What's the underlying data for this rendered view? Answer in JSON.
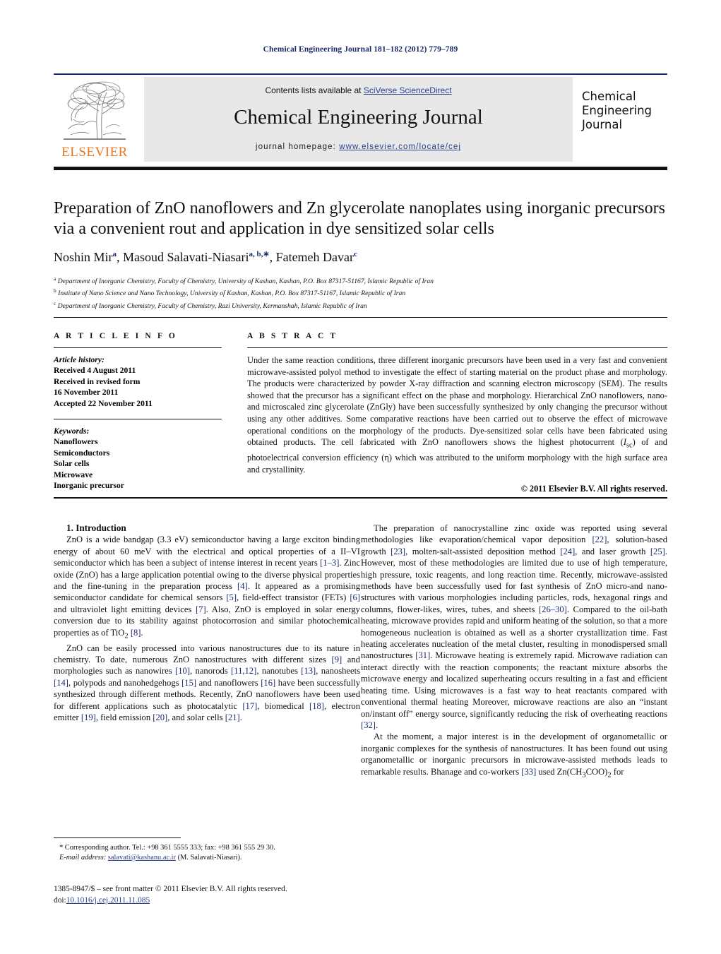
{
  "running_head": "Chemical Engineering Journal 181–182 (2012) 779–789",
  "masthead": {
    "publisher_name": "ELSEVIER",
    "contents_prefix": "Contents lists available at ",
    "contents_link": "SciVerse ScienceDirect",
    "journal_title": "Chemical Engineering Journal",
    "homepage_prefix": "journal homepage: ",
    "homepage_url": "www.elsevier.com/locate/cej",
    "cover_line1": "Chemical",
    "cover_line2": "Engineering",
    "cover_line3": "Journal",
    "accent_orange": "#E87722",
    "accent_blue": "#2b3f8c",
    "band_gray": "#e8e8e8"
  },
  "article": {
    "title": "Preparation of ZnO nanoflowers and Zn glycerolate nanoplates using inorganic precursors via a convenient rout and application in dye sensitized solar cells",
    "authors": [
      {
        "name": "Noshin Mir",
        "marks": "a"
      },
      {
        "name": "Masoud Salavati-Niasari",
        "marks": "a, b,∗"
      },
      {
        "name": "Fatemeh Davar",
        "marks": "c"
      }
    ],
    "affiliations": [
      {
        "mark": "a",
        "text": "Department of Inorganic Chemistry, Faculty of Chemistry, University of Kashan, Kashan, P.O. Box 87317-51167, Islamic Republic of Iran"
      },
      {
        "mark": "b",
        "text": "Institute of Nano Science and Nano Technology, University of Kashan, Kashan, P.O. Box 87317-51167, Islamic Republic of Iran"
      },
      {
        "mark": "c",
        "text": "Department of Inorganic Chemistry, Faculty of Chemistry, Razi University, Kermanshah, Islamic Republic of Iran"
      }
    ]
  },
  "article_info": {
    "heading": "A R T I C L E   I N F O",
    "history_label": "Article history:",
    "history": [
      "Received 4 August 2011",
      "Received in revised form",
      "16 November 2011",
      "Accepted 22 November 2011"
    ],
    "keywords_label": "Keywords:",
    "keywords": [
      "Nanoflowers",
      "Semiconductors",
      "Solar cells",
      "Microwave",
      "Inorganic precursor"
    ]
  },
  "abstract": {
    "heading": "A B S T R A C T",
    "text": "Under the same reaction conditions, three different inorganic precursors have been used in a very fast and convenient microwave-assisted polyol method to investigate the effect of starting material on the product phase and morphology. The products were characterized by powder X-ray diffraction and scanning electron microscopy (SEM). The results showed that the precursor has a significant effect on the phase and morphology. Hierarchical ZnO nanoflowers, nano- and microscaled zinc glycerolate (ZnGly) have been successfully synthesized by only changing the precursor without using any other additives. Some comparative reactions have been carried out to observe the effect of microwave operational conditions on the morphology of the products. Dye-sensitized solar cells have been fabricated using obtained products. The cell fabricated with ZnO nanoflowers shows the highest photocurrent (Isc) of and photoelectrical conversion efficiency (η) which was attributed to the uniform morphology with the high surface area and crystallinity.",
    "copyright": "© 2011 Elsevier B.V. All rights reserved."
  },
  "body": {
    "section_number": "1.",
    "section_title": "Introduction",
    "left_paragraphs": [
      "ZnO is a wide bandgap (3.3 eV) semiconductor having a large exciton binding energy of about 60 meV with the electrical and optical properties of a II–VI semiconductor which has been a subject of intense interest in recent years [1–3]. Zinc oxide (ZnO) has a large application potential owing to the diverse physical properties and the fine-tuning in the preparation process [4]. It appeared as a promising semiconductor candidate for chemical sensors [5], field-effect transistor (FETs) [6] and ultraviolet light emitting devices [7]. Also, ZnO is employed in solar energy conversion due to its stability against photocorrosion and similar photochemical properties as of TiO2 [8].",
      "ZnO can be easily processed into various nanostructures due to its nature in chemistry. To date, numerous ZnO nanostructures with different sizes [9] and morphologies such as nanowires [10], nanorods [11,12], nanotubes [13], nanosheets [14], polypods and nanohedgehogs [15] and nanoflowers [16] have been successfully synthesized through different methods. Recently, ZnO nanoflowers have been used for different applications such as photocatalytic [17], biomedical [18], electron emitter [19], field emission [20], and solar cells [21]."
    ],
    "right_paragraphs": [
      "The preparation of nanocrystalline zinc oxide was reported using several methodologies like evaporation/chemical vapor deposition [22], solution-based growth [23], molten-salt-assisted deposition method [24], and laser growth [25]. However, most of these methodologies are limited due to use of high temperature, high pressure, toxic reagents, and long reaction time. Recently, microwave-assisted methods have been successfully used for fast synthesis of ZnO micro-and nano-structures with various morphologies including particles, rods, hexagonal rings and columns, flower-likes, wires, tubes, and sheets [26–30]. Compared to the oil-bath heating, microwave provides rapid and uniform heating of the solution, so that a more homogeneous nucleation is obtained as well as a shorter crystallization time. Fast heating accelerates nucleation of the metal cluster, resulting in monodispersed small nanostructures [31]. Microwave heating is extremely rapid. Microwave radiation can interact directly with the reaction components; the reactant mixture absorbs the microwave energy and localized superheating occurs resulting in a fast and efficient heating time. Using microwaves is a fast way to heat reactants compared with conventional thermal heating Moreover, microwave reactions are also an “instant on/instant off” energy source, significantly reducing the risk of overheating reactions [32].",
      "At the moment, a major interest is in the development of organometallic or inorganic complexes for the synthesis of nanostructures. It has been found out using organometallic or inorganic precursors in microwave-assisted methods leads to remarkable results. Bhanage and co-workers [33] used Zn(CH3COO)2 for"
    ]
  },
  "footnote": {
    "corresponding": "* Corresponding author. Tel.: +98 361 5555 333; fax: +98 361 555 29 30.",
    "email_label": "E-mail address:",
    "email": "salavati@kashanu.ac.ir",
    "email_owner": "(M. Salavati-Niasari)."
  },
  "imprint": {
    "line1": "1385-8947/$ – see front matter © 2011 Elsevier B.V. All rights reserved.",
    "doi_label": "doi:",
    "doi": "10.1016/j.cej.2011.11.085"
  }
}
